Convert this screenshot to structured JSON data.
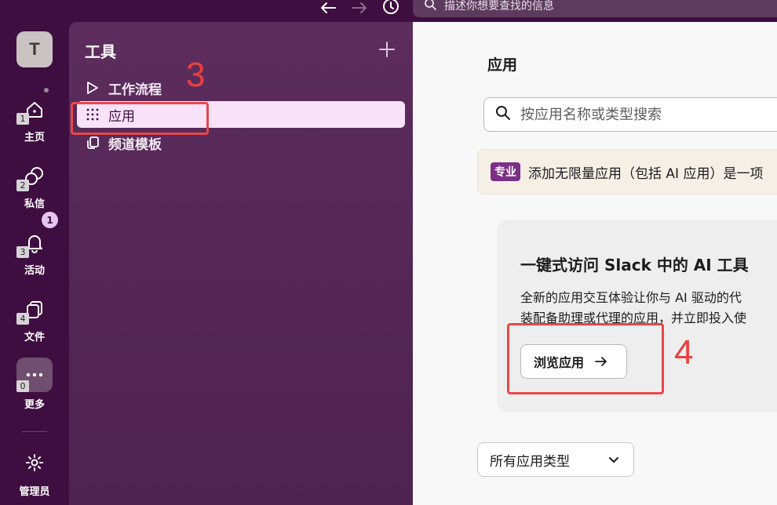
{
  "topbar": {
    "search_placeholder": "描述你想要查找的信息",
    "back_icon": "arrow-left-icon",
    "forward_icon": "arrow-right-icon",
    "history_icon": "clock-icon"
  },
  "rail": {
    "workspace_initial": "T",
    "items": [
      {
        "label": "主页",
        "number": "1",
        "icon": "home-icon"
      },
      {
        "label": "私信",
        "number": "2",
        "icon": "messages-icon"
      },
      {
        "label": "活动",
        "number": "3",
        "icon": "bell-icon",
        "badge": "1"
      },
      {
        "label": "文件",
        "number": "4",
        "icon": "files-icon"
      },
      {
        "label": "更多",
        "number": "0",
        "icon": "more-icon"
      }
    ],
    "admin_label": "管理员"
  },
  "sidebar": {
    "title": "工具",
    "items": [
      {
        "label": "工作流程",
        "icon": "play-icon"
      },
      {
        "label": "应用",
        "icon": "grid-icon"
      },
      {
        "label": "频道模板",
        "icon": "copy-icon"
      }
    ],
    "annotation": "3"
  },
  "main": {
    "title": "应用",
    "search_placeholder": "按应用名称或类型搜索",
    "promo": {
      "badge": "专业",
      "text": "添加无限量应用（包括 AI 应用）是一项"
    },
    "card": {
      "title": "一键式访问 Slack 中的 AI 工具",
      "desc_line1": "全新的应用交互体验让你与 AI 驱动的代",
      "desc_line2": "装配备助理或代理的应用，并立即投入使",
      "button": "浏览应用",
      "annotation": "4"
    },
    "filter_select": "所有应用类型"
  },
  "colors": {
    "rail_bg": "#3f0e40",
    "sidebar_bg": "#5c2d5d",
    "active_item": "#f8e2f8",
    "annotation": "#e8474a",
    "pro_badge": "#7c3085"
  }
}
